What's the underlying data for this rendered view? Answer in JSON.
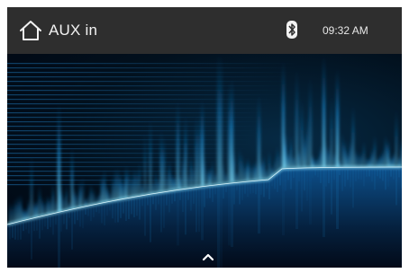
{
  "status_bar": {
    "source_title": "AUX in",
    "home_icon": "home-icon",
    "bluetooth_icon": "bluetooth-icon",
    "time": "09:32 AM"
  },
  "visualizer": {
    "description_icon": "audio-spectrum-visualizer",
    "accent_color": "#2fb8ff"
  },
  "bottom_control": {
    "icon": "chevron-up-icon"
  }
}
